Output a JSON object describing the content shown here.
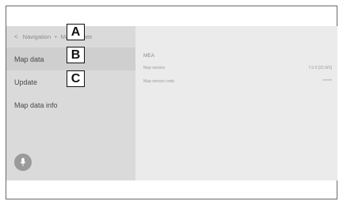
{
  "breadcrumb": {
    "back_glyph": "<",
    "parent": "Navigation",
    "separator": "•",
    "current": "Map update"
  },
  "menu": {
    "items": [
      {
        "label": "Map data",
        "callout": "A",
        "selected": true
      },
      {
        "label": "Update",
        "callout": "B",
        "selected": false
      },
      {
        "label": "Map data info",
        "callout": "C",
        "selected": false
      }
    ]
  },
  "details": {
    "section_title": "MEA",
    "rows": [
      {
        "label": "Map version",
        "value": "7.0.0 [22.W1]"
      },
      {
        "label": "Map service code",
        "value": "******"
      }
    ]
  },
  "icons": {
    "voice": "microphone-icon"
  },
  "colors": {
    "left_panel": "#dadada",
    "right_panel": "#ebebeb",
    "selected_item": "#cfcfcf",
    "mic_button": "#9a9a9a"
  }
}
